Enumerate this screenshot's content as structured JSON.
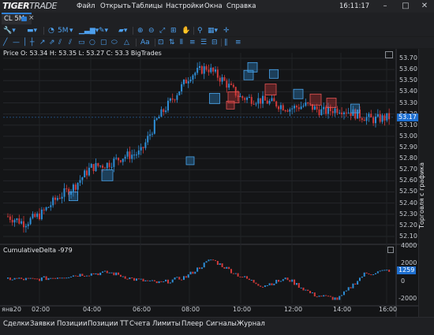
{
  "app": {
    "logo_main": "TIGER",
    "logo_sub": "TRADE"
  },
  "menu": [
    "Файл",
    "Открыть",
    "Таблицы",
    "Настройки",
    "Окна",
    "Справка"
  ],
  "clock": "16:11:17",
  "tab": {
    "label": "CL 5M"
  },
  "toolbar": {
    "timeframe": "5M"
  },
  "price_panel": {
    "legend": "Price O: 53.34 H: 53.35 L: 53.27 C: 53.3 BigTrades",
    "current_price": "53.17",
    "y_labels": [
      "53.70",
      "53.60",
      "53.50",
      "53.40",
      "53.30",
      "53.20",
      "53.10",
      "53.00",
      "52.90",
      "52.80",
      "52.70",
      "52.60",
      "52.50",
      "52.40",
      "52.30",
      "52.20",
      "52.10"
    ]
  },
  "delta_panel": {
    "legend": "CumulativeDelta  -979",
    "current_value": "1259",
    "y_labels": [
      "4000",
      "2000",
      "0",
      "-2000"
    ]
  },
  "x_labels": [
    "янв20",
    "02:00",
    "04:00",
    "06:00",
    "08:00",
    "10:00",
    "12:00",
    "14:00",
    "16:00"
  ],
  "side_panel": {
    "label": "Торговля с графика"
  },
  "bottom_tabs": [
    "Сделки",
    "Заявки",
    "Позиции",
    "Позиции ТТ",
    "Счета",
    "Лимиты",
    "Плеер",
    "Сигналы",
    "Журнал"
  ],
  "colors": {
    "up": "#2e8fd8",
    "down": "#d23a3a",
    "accent": "#2e7fd6",
    "bg": "#141517"
  },
  "chart_data": [
    {
      "type": "candlestick",
      "title": "Price",
      "x": [
        "01:00",
        "02:00",
        "03:00",
        "04:00",
        "05:00",
        "06:00",
        "07:00",
        "08:00",
        "08:30",
        "09:00",
        "09:30",
        "10:00",
        "10:30",
        "11:00",
        "11:30",
        "12:00",
        "12:30",
        "13:00",
        "13:30",
        "14:00",
        "14:30",
        "15:00",
        "15:30",
        "16:00"
      ],
      "close": [
        52.28,
        52.22,
        52.3,
        52.45,
        52.55,
        52.72,
        52.75,
        52.82,
        52.85,
        53.15,
        53.35,
        53.55,
        53.62,
        53.5,
        53.35,
        53.33,
        53.3,
        53.25,
        53.28,
        53.22,
        53.25,
        53.2,
        53.15,
        53.17
      ],
      "ylim": [
        52.05,
        53.75
      ]
    },
    {
      "type": "bar",
      "title": "CumulativeDelta",
      "x": [
        "01:00",
        "02:00",
        "03:00",
        "04:00",
        "05:00",
        "06:00",
        "07:00",
        "08:00",
        "09:00",
        "10:00",
        "11:00",
        "12:00",
        "13:00",
        "14:00",
        "15:00",
        "16:00"
      ],
      "values": [
        300,
        200,
        500,
        800,
        1000,
        200,
        -200,
        500,
        2500,
        800,
        -500,
        300,
        -1500,
        -2000,
        800,
        1259
      ],
      "ylim": [
        -2500,
        4000
      ]
    }
  ]
}
